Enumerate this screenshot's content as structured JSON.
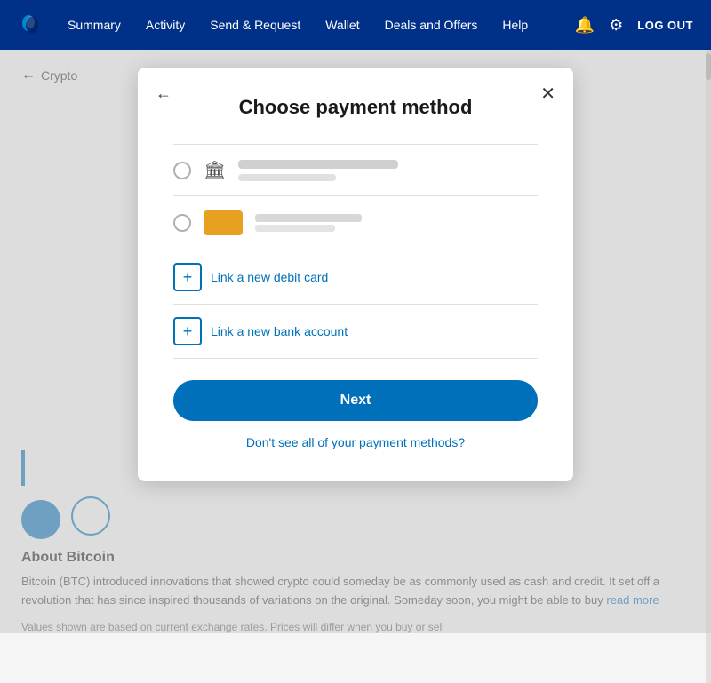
{
  "navbar": {
    "links": [
      {
        "label": "Summary",
        "active": false
      },
      {
        "label": "Activity",
        "active": false
      },
      {
        "label": "Send & Request",
        "active": false
      },
      {
        "label": "Wallet",
        "active": false
      },
      {
        "label": "Deals and Offers",
        "active": false
      },
      {
        "label": "Help",
        "active": false
      }
    ],
    "logout_label": "LOG OUT"
  },
  "breadcrumb": {
    "back_label": "Crypto"
  },
  "modal": {
    "title": "Choose payment method",
    "next_button": "Next",
    "dont_see_link": "Don't see all of your payment methods?",
    "link_debit_label": "Link a new debit card",
    "link_bank_label": "Link a new bank account"
  },
  "about": {
    "title": "About Bitcoin",
    "text": "Bitcoin (BTC) introduced innovations that showed crypto could someday be as commonly used as cash and credit. It set off a revolution that has since inspired thousands of variations on the original. Someday soon, you might be able to buy",
    "read_more": "read more"
  },
  "disclaimer": "Values shown are based on current exchange rates. Prices will differ when you buy or sell"
}
